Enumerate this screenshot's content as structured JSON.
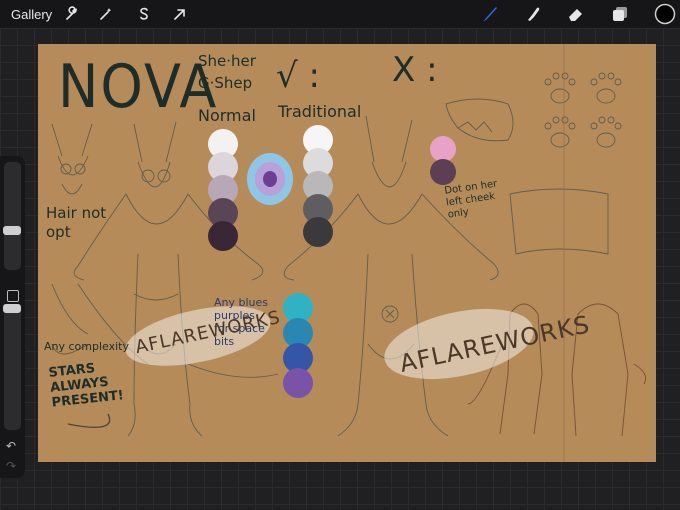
{
  "toolbar": {
    "gallery_label": "Gallery",
    "left_icons": [
      "wrench-icon",
      "magic-wand-icon",
      "selection-s-icon",
      "transform-arrow-icon"
    ],
    "right_icons": [
      "brush-icon",
      "smudge-icon",
      "eraser-icon",
      "layers-icon"
    ],
    "active_tool": "brush-icon",
    "brush_color": "#2f6fe0",
    "current_color": "#000000"
  },
  "sidebar": {
    "brush_size_level": 0.35,
    "opacity_level": 0.15,
    "icons": [
      "modify-square-icon",
      "undo-icon",
      "redo-icon"
    ]
  },
  "artwork": {
    "name": "NOVA",
    "pronouns": "She·her",
    "breed": "G·Shep",
    "check_mark": "√ :",
    "cross_mark": "X :",
    "normal_label": "Normal",
    "traditional_label": "Traditional",
    "hair_note": "Hair not\nopt",
    "dot_note": "Dot on her\nleft cheek\nonly",
    "complexity_note": "Any complexity",
    "stars_note": "STARS\nALWAYS\nPRESENT!",
    "blues_note": "Any blues\npurples\nfor space\nbits",
    "watermark": "AFLAREWORKS",
    "colors": {
      "normal": [
        "#f4f1f1",
        "#dcd6db",
        "#b6a8b7",
        "#5a4556",
        "#3a2736"
      ],
      "traditional": [
        "#f6f6f6",
        "#dcdcdc",
        "#b8b8b8",
        "#5e5e60",
        "#3a3a3c"
      ],
      "space": [
        "#2fb2c4",
        "#2a86b2",
        "#3455a8",
        "#7a52a8"
      ],
      "dot": [
        "#e8a2c6",
        "#5c3f52"
      ],
      "eye": [
        "#8fc6e6",
        "#b8a0d8",
        "#6b3f92"
      ],
      "canvas": "#b58b5a",
      "ink": "#1d2d2a"
    }
  }
}
